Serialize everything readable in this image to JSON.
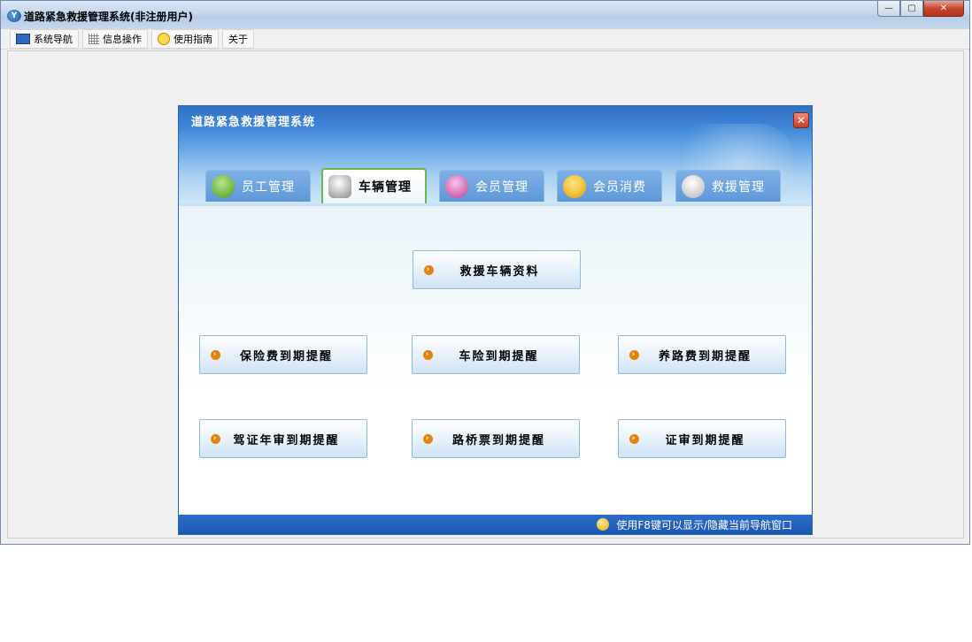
{
  "window": {
    "title": "道路紧急救援管理系统(非注册用户)",
    "app_icon": "app-logo-icon",
    "caption": {
      "minimize": "—",
      "restore": "▢",
      "close": "✕"
    }
  },
  "menubar": {
    "items": [
      {
        "label": "系统导航",
        "icon": "monitor-icon"
      },
      {
        "label": "信息操作",
        "icon": "grid-icon"
      },
      {
        "label": "使用指南",
        "icon": "bulb-icon"
      },
      {
        "label": "关于",
        "icon": ""
      }
    ]
  },
  "dialog": {
    "title": "道路紧急救援管理系统",
    "close_glyph": "✕",
    "tabs": [
      {
        "label": "员工管理",
        "icon": "users-icon",
        "active": false
      },
      {
        "label": "车辆管理",
        "icon": "ambulance-icon",
        "active": true
      },
      {
        "label": "会员管理",
        "icon": "members-icon",
        "active": false
      },
      {
        "label": "会员消费",
        "icon": "consume-icon",
        "active": false
      },
      {
        "label": "救援管理",
        "icon": "rescue-icon",
        "active": false
      }
    ],
    "buttons": {
      "rescue_vehicle_info": "救援车辆资料",
      "insurance_fee_reminder": "保险费到期提醒",
      "vehicle_insurance_reminder": "车险到期提醒",
      "road_maintenance_fee_reminder": "养路费到期提醒",
      "license_review_reminder": "驾证年审到期提醒",
      "toll_ticket_reminder": "路桥票到期提醒",
      "certificate_review_reminder": "证审到期提醒"
    },
    "status": "使用F8键可以显示/隐藏当前导航窗口"
  },
  "colors": {
    "dialog_header": "#3f86d8",
    "active_tab_border": "#6db64a",
    "status_bar": "#1b58b4",
    "arrow_icon": "#e8820c"
  }
}
